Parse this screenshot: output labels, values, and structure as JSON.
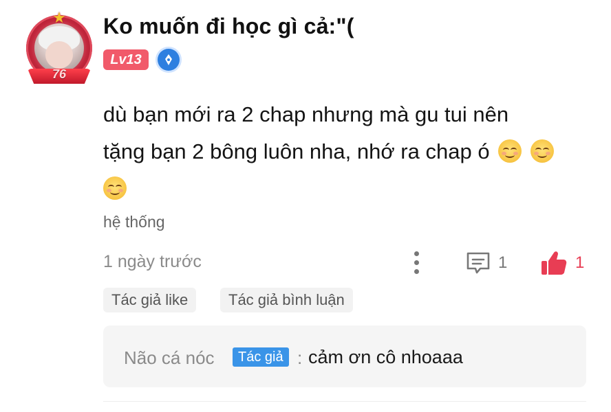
{
  "user": {
    "name": "Ko muốn đi học gì cả:\"(",
    "level_badge": "Lv13",
    "avatar_frame_number": "76"
  },
  "comment": {
    "text_line1": "dù bạn mới ra 2 chap nhưng mà gu tui nên",
    "text_line2": "tặng bạn 2 bông luôn nha, nhớ ra chap ó",
    "emoji_name": "smiling-face-emoji"
  },
  "system_tag": "hệ thống",
  "meta": {
    "time": "1 ngày trước",
    "reply_count": "1",
    "like_count": "1"
  },
  "chips": {
    "author_like": "Tác giả like",
    "author_reply": "Tác giả bình luận"
  },
  "reply": {
    "author": "Não cá nóc",
    "author_tag": "Tác giả",
    "separator": ":",
    "text": "cảm ơn cô nhoaaa"
  },
  "colors": {
    "like_red": "#e83d54",
    "level_badge": "#f15a6a",
    "author_tag_blue": "#3a94e8"
  }
}
